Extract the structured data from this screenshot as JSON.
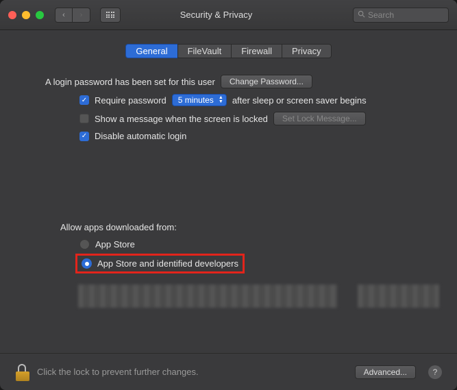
{
  "window": {
    "title": "Security & Privacy"
  },
  "search": {
    "placeholder": "Search"
  },
  "tabs": [
    {
      "label": "General",
      "active": true
    },
    {
      "label": "FileVault",
      "active": false
    },
    {
      "label": "Firewall",
      "active": false
    },
    {
      "label": "Privacy",
      "active": false
    }
  ],
  "login": {
    "password_set_text": "A login password has been set for this user",
    "change_password_btn": "Change Password...",
    "require_pw_label": "Require password",
    "require_pw_checked": true,
    "delay_value": "5 minutes",
    "after_text": "after sleep or screen saver begins",
    "show_msg_label": "Show a message when the screen is locked",
    "show_msg_checked": false,
    "set_lock_msg_btn": "Set Lock Message...",
    "disable_auto_label": "Disable automatic login",
    "disable_auto_checked": true
  },
  "allow_apps": {
    "heading": "Allow apps downloaded from:",
    "options": [
      {
        "label": "App Store",
        "selected": false
      },
      {
        "label": "App Store and identified developers",
        "selected": true
      }
    ]
  },
  "footer": {
    "lock_text": "Click the lock to prevent further changes.",
    "advanced_btn": "Advanced..."
  }
}
